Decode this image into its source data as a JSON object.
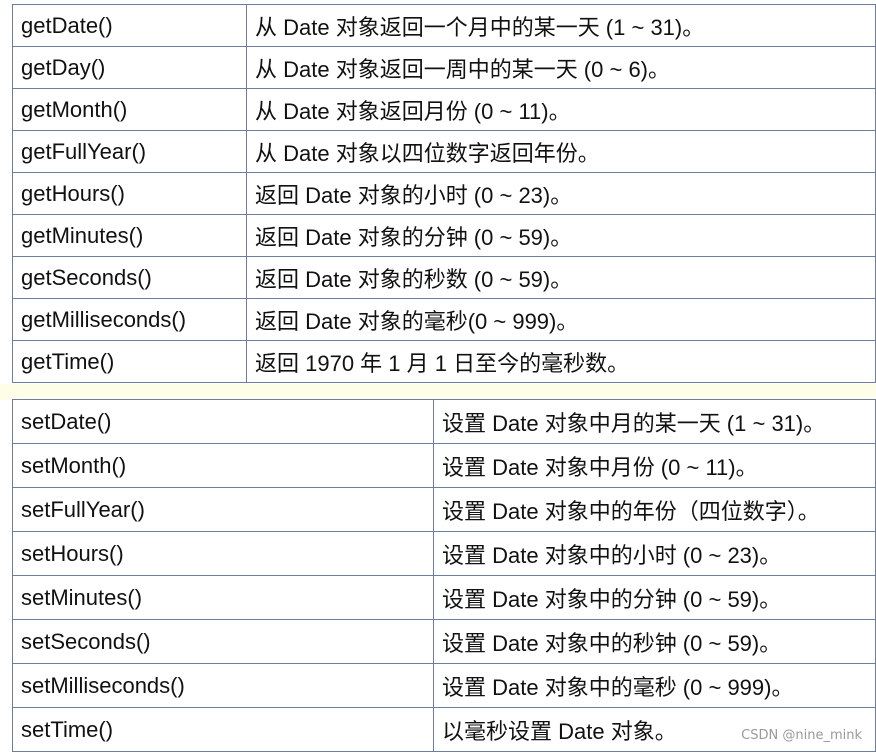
{
  "get_methods": [
    {
      "method": "getDate()",
      "description": "从 Date 对象返回一个月中的某一天 (1 ~ 31)。"
    },
    {
      "method": "getDay()",
      "description": "从 Date 对象返回一周中的某一天 (0 ~ 6)。"
    },
    {
      "method": "getMonth()",
      "description": "从 Date 对象返回月份 (0 ~ 11)。"
    },
    {
      "method": "getFullYear()",
      "description": "从 Date 对象以四位数字返回年份。"
    },
    {
      "method": "getHours()",
      "description": "返回 Date 对象的小时 (0 ~ 23)。"
    },
    {
      "method": "getMinutes()",
      "description": "返回 Date 对象的分钟 (0 ~ 59)。"
    },
    {
      "method": "getSeconds()",
      "description": "返回 Date 对象的秒数 (0 ~ 59)。"
    },
    {
      "method": "getMilliseconds()",
      "description": "返回 Date 对象的毫秒(0 ~ 999)。"
    },
    {
      "method": "getTime()",
      "description": "返回 1970 年 1 月 1 日至今的毫秒数。"
    }
  ],
  "set_methods": [
    {
      "method": "setDate()",
      "description": "设置 Date 对象中月的某一天 (1 ~ 31)。"
    },
    {
      "method": "setMonth()",
      "description": "设置 Date 对象中月份 (0 ~ 11)。"
    },
    {
      "method": "setFullYear()",
      "description": "设置 Date 对象中的年份（四位数字）。"
    },
    {
      "method": "setHours()",
      "description": "设置 Date 对象中的小时 (0 ~ 23)。"
    },
    {
      "method": "setMinutes()",
      "description": "设置 Date 对象中的分钟 (0 ~ 59)。"
    },
    {
      "method": "setSeconds()",
      "description": "设置 Date 对象中的秒钟 (0 ~ 59)。"
    },
    {
      "method": "setMilliseconds()",
      "description": "设置 Date 对象中的毫秒 (0 ~ 999)。"
    },
    {
      "method": "setTime()",
      "description": "以毫秒设置 Date 对象。"
    }
  ],
  "watermark": "CSDN @nine_mink"
}
